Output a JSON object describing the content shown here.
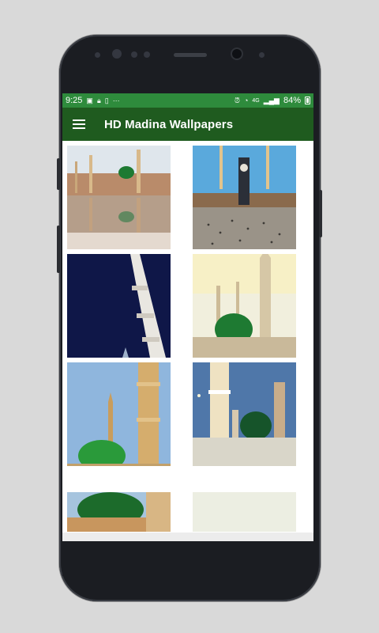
{
  "status_bar": {
    "time": "9:25",
    "left_icons": [
      "image-icon",
      "lock-icon",
      "sim-icon",
      "more-dots-icon"
    ],
    "right_icons": [
      "alarm-icon",
      "wifi-icon",
      "network-4g-icon",
      "signal-icon"
    ],
    "battery_percent": "84%"
  },
  "toolbar": {
    "title": "HD Madina Wallpapers",
    "menu_icon": "hamburger-menu-icon"
  },
  "wallpapers": [
    {
      "label": "wallpaper-1"
    },
    {
      "label": "wallpaper-2"
    },
    {
      "label": "wallpaper-3"
    },
    {
      "label": "wallpaper-4"
    },
    {
      "label": "wallpaper-5"
    },
    {
      "label": "wallpaper-6"
    },
    {
      "label": "wallpaper-7"
    },
    {
      "label": "wallpaper-8"
    }
  ],
  "colors": {
    "status_bar": "#2e8b3c",
    "toolbar": "#1f5b1f",
    "dome_green": "#1e7a32"
  }
}
